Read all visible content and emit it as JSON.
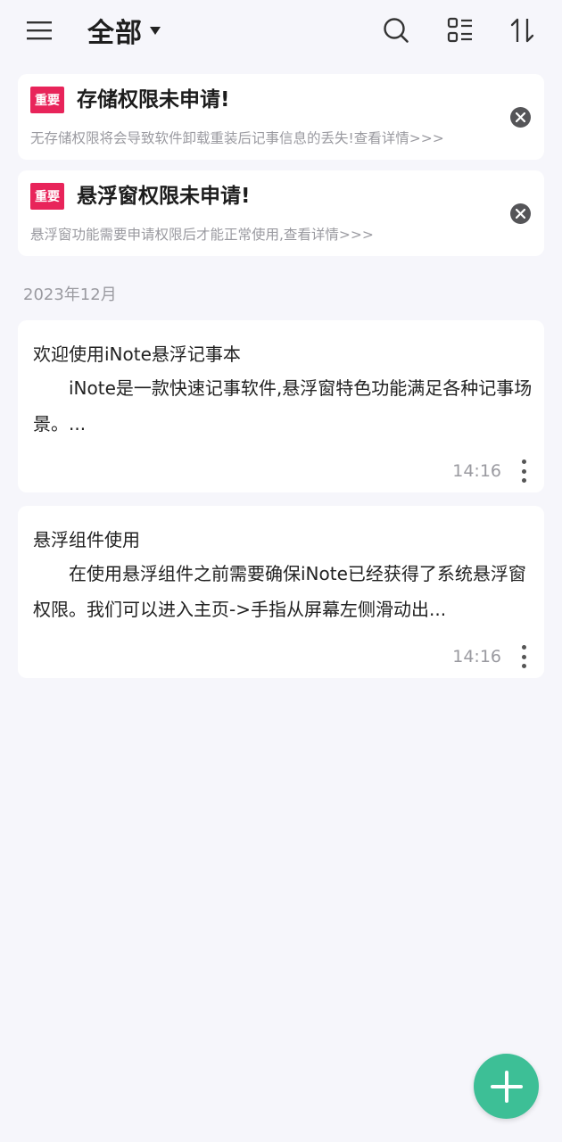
{
  "header": {
    "title": "全部",
    "icons": [
      "menu-icon",
      "caret-down-icon",
      "search-icon",
      "list-layout-icon",
      "sort-icon"
    ]
  },
  "warnings": [
    {
      "badge": "重要",
      "title": "存储权限未申请!",
      "description": "无存储权限将会导致软件卸载重装后记事信息的丢失!查看详情>>>"
    },
    {
      "badge": "重要",
      "title": "悬浮窗权限未申请!",
      "description": "悬浮窗功能需要申请权限后才能正常使用,查看详情>>>"
    }
  ],
  "group": {
    "date": "2023年12月"
  },
  "notes": [
    {
      "title": "欢迎使用iNote悬浮记事本",
      "body": "iNote是一款快速记事软件,悬浮窗特色功能满足各种记事场景。...",
      "time": "14:16"
    },
    {
      "title": "悬浮组件使用",
      "body": "在使用悬浮组件之前需要确保iNote已经获得了系统悬浮窗权限。我们可以进入主页->手指从屏幕左侧滑动出...",
      "time": "14:16"
    }
  ],
  "colors": {
    "accent": "#3dbf96",
    "badge": "#e8245a",
    "background": "#f6f6fb"
  }
}
